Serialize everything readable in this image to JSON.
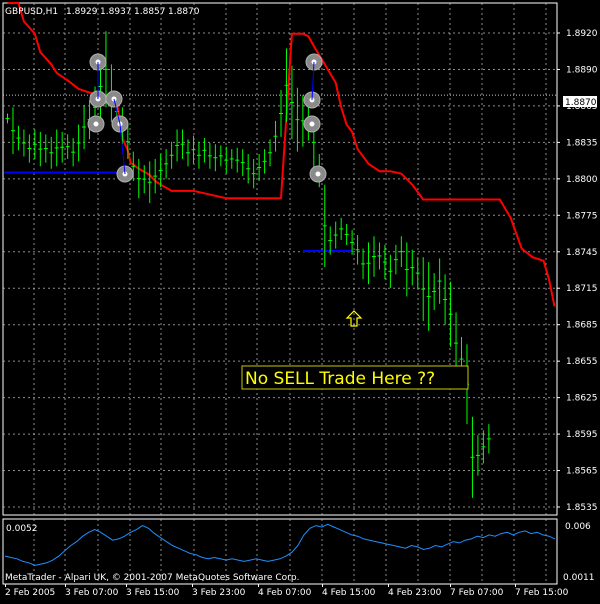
{
  "header": {
    "symbol_tf": "GBPUSD,H1",
    "open": "1.8929",
    "high": "1.8937",
    "low": "1.8857",
    "close": "1.8870"
  },
  "main_panel": {
    "y_ticks": [
      "1.8920",
      "1.8890",
      "1.8865",
      "1.8835",
      "1.8800",
      "1.8775",
      "1.8745",
      "1.8715",
      "1.8685",
      "1.8655",
      "1.8625",
      "1.8595",
      "1.8565",
      "1.8535"
    ],
    "current_price_label": "1.8870",
    "annotation": "No SELL Trade Here ??"
  },
  "sub_panel": {
    "value_label": "0.0052",
    "scale_max": "0.006",
    "scale_min": "0.0011"
  },
  "x_ticks": [
    "2 Feb 2005",
    "3 Feb 07:00",
    "3 Feb 15:00",
    "3 Feb 23:00",
    "4 Feb 07:00",
    "4 Feb 15:00",
    "4 Feb 23:00",
    "7 Feb 07:00",
    "7 Feb 15:00"
  ],
  "copyright": "MetaTrader - Alpari UK, © 2001-2007 MetaQuotes Software Corp.",
  "colors": {
    "background": "#000000",
    "grid": "#c8c8c8",
    "bars": "#00ff00",
    "trailing_stop": "#ff0000",
    "level_line": "#0000ff",
    "indicator": "#1e90ff",
    "annotation_text": "#ffff00"
  },
  "chart_data": [
    {
      "type": "candlestick",
      "title": "GBPUSD,H1",
      "ylim": [
        1.8528,
        1.8945
      ],
      "x_labels": [
        "2 Feb 2005",
        "3 Feb 07:00",
        "3 Feb 15:00",
        "3 Feb 23:00",
        "4 Feb 07:00",
        "4 Feb 15:00",
        "4 Feb 23:00",
        "7 Feb 07:00",
        "7 Feb 15:00"
      ],
      "grid": true,
      "bars": [
        [
          1.8847,
          1.8855
        ],
        [
          1.8822,
          1.886
        ],
        [
          1.8825,
          1.8845
        ],
        [
          1.882,
          1.8842
        ],
        [
          1.8815,
          1.8838
        ],
        [
          1.8818,
          1.8842
        ],
        [
          1.8812,
          1.884
        ],
        [
          1.8815,
          1.8838
        ],
        [
          1.881,
          1.8836
        ],
        [
          1.8812,
          1.8842
        ],
        [
          1.8815,
          1.884
        ],
        [
          1.8818,
          1.8838
        ],
        [
          1.8812,
          1.8835
        ],
        [
          1.8816,
          1.8846
        ],
        [
          1.8826,
          1.8862
        ],
        [
          1.8834,
          1.8866
        ],
        [
          1.8843,
          1.8877
        ],
        [
          1.8852,
          1.8902
        ],
        [
          1.886,
          1.8922
        ],
        [
          1.8848,
          1.8895
        ],
        [
          1.884,
          1.8873
        ],
        [
          1.883,
          1.886
        ],
        [
          1.8818,
          1.8846
        ],
        [
          1.88,
          1.8824
        ],
        [
          1.8786,
          1.8818
        ],
        [
          1.879,
          1.8813
        ],
        [
          1.8782,
          1.8816
        ],
        [
          1.879,
          1.8818
        ],
        [
          1.8795,
          1.8822
        ],
        [
          1.8802,
          1.8826
        ],
        [
          1.881,
          1.8832
        ],
        [
          1.8816,
          1.8842
        ],
        [
          1.8818,
          1.8842
        ],
        [
          1.8812,
          1.8834
        ],
        [
          1.8814,
          1.8837
        ],
        [
          1.881,
          1.8832
        ],
        [
          1.8815,
          1.8835
        ],
        [
          1.881,
          1.8831
        ],
        [
          1.8808,
          1.883
        ],
        [
          1.8812,
          1.8829
        ],
        [
          1.8806,
          1.8828
        ],
        [
          1.881,
          1.8826
        ],
        [
          1.8807,
          1.8827
        ],
        [
          1.8804,
          1.8826
        ],
        [
          1.8798,
          1.8822
        ],
        [
          1.8794,
          1.8818
        ],
        [
          1.88,
          1.8822
        ],
        [
          1.8806,
          1.8826
        ],
        [
          1.8812,
          1.8834
        ],
        [
          1.8824,
          1.8849
        ],
        [
          1.8836,
          1.8874
        ],
        [
          1.8848,
          1.8908
        ],
        [
          1.8834,
          1.8894
        ],
        [
          1.8824,
          1.8876
        ],
        [
          1.8828,
          1.887
        ],
        [
          1.8833,
          1.886
        ],
        [
          1.881,
          1.8853
        ],
        [
          1.8795,
          1.8822
        ],
        [
          1.873,
          1.8797
        ],
        [
          1.874,
          1.8763
        ],
        [
          1.8745,
          1.8767
        ],
        [
          1.8752,
          1.877
        ],
        [
          1.8748,
          1.8765
        ],
        [
          1.874,
          1.876
        ],
        [
          1.8732,
          1.8756
        ],
        [
          1.872,
          1.8745
        ],
        [
          1.8716,
          1.875
        ],
        [
          1.8722,
          1.8755
        ],
        [
          1.8728,
          1.875
        ],
        [
          1.872,
          1.8748
        ],
        [
          1.8713,
          1.874
        ],
        [
          1.8724,
          1.8748
        ],
        [
          1.873,
          1.8755
        ],
        [
          1.8706,
          1.875
        ],
        [
          1.8715,
          1.8744
        ],
        [
          1.8712,
          1.8738
        ],
        [
          1.8686,
          1.8738
        ],
        [
          1.8678,
          1.8734
        ],
        [
          1.8695,
          1.8725
        ],
        [
          1.87,
          1.8737
        ],
        [
          1.8683,
          1.8724
        ],
        [
          1.8665,
          1.8718
        ],
        [
          1.8643,
          1.8693
        ],
        [
          1.8637,
          1.8673
        ],
        [
          1.8602,
          1.8667
        ],
        [
          1.8542,
          1.8608
        ],
        [
          1.856,
          1.8593
        ],
        [
          1.857,
          1.8597
        ],
        [
          1.8578,
          1.8602
        ]
      ],
      "trailing_stop_series": [
        [
          0,
          1.8945
        ],
        [
          2,
          1.8945
        ],
        [
          3,
          1.893
        ],
        [
          5,
          1.892
        ],
        [
          6,
          1.8905
        ],
        [
          8,
          1.8895
        ],
        [
          9,
          1.8888
        ],
        [
          11,
          1.8882
        ],
        [
          13,
          1.8875
        ],
        [
          15,
          1.8872
        ],
        [
          17,
          1.887
        ],
        [
          18,
          1.8868
        ],
        [
          19,
          1.8868
        ],
        [
          19.9,
          1.8868
        ],
        [
          20.3,
          1.8855
        ],
        [
          21,
          1.8835
        ],
        [
          22,
          1.8825
        ],
        [
          22.5,
          1.8815
        ],
        [
          24,
          1.881
        ],
        [
          26,
          1.8805
        ],
        [
          27,
          1.88
        ],
        [
          28,
          1.8797
        ],
        [
          30,
          1.8792
        ],
        [
          32,
          1.8792
        ],
        [
          34,
          1.8792
        ],
        [
          36,
          1.879
        ],
        [
          38,
          1.8788
        ],
        [
          40,
          1.8786
        ],
        [
          42,
          1.8786
        ],
        [
          44,
          1.8786
        ],
        [
          46,
          1.8786
        ],
        [
          48,
          1.8786
        ],
        [
          50,
          1.8786
        ],
        [
          52,
          1.892
        ],
        [
          54,
          1.892
        ],
        [
          55,
          1.8918
        ],
        [
          56,
          1.891
        ],
        [
          58,
          1.8895
        ],
        [
          60,
          1.888
        ],
        [
          61,
          1.886
        ],
        [
          62,
          1.8846
        ],
        [
          63,
          1.884
        ],
        [
          64,
          1.8826
        ],
        [
          66,
          1.8814
        ],
        [
          68,
          1.8808
        ],
        [
          70,
          1.8808
        ],
        [
          72,
          1.8806
        ],
        [
          74,
          1.8797
        ],
        [
          76,
          1.8785
        ],
        [
          78,
          1.8785
        ],
        [
          80,
          1.8785
        ],
        [
          82,
          1.8785
        ],
        [
          84,
          1.8785
        ],
        [
          86,
          1.8785
        ],
        [
          88,
          1.8785
        ],
        [
          90,
          1.8785
        ],
        [
          92,
          1.877
        ],
        [
          94,
          1.8745
        ],
        [
          96,
          1.8738
        ],
        [
          98,
          1.8735
        ],
        [
          99,
          1.872
        ],
        [
          100,
          1.8698
        ]
      ]
    },
    {
      "type": "line",
      "title": "",
      "ylim": [
        0.0011,
        0.006
      ],
      "values": [
        0.0032,
        0.0031,
        0.003,
        0.0028,
        0.0027,
        0.0025,
        0.0026,
        0.0027,
        0.0029,
        0.0032,
        0.0036,
        0.004,
        0.0043,
        0.0047,
        0.005,
        0.0052,
        0.005,
        0.0047,
        0.0044,
        0.0045,
        0.0047,
        0.005,
        0.0052,
        0.0055,
        0.0053,
        0.0049,
        0.0046,
        0.0043,
        0.004,
        0.0038,
        0.0036,
        0.0034,
        0.0033,
        0.0031,
        0.003,
        0.0031,
        0.003,
        0.0029,
        0.003,
        0.0029,
        0.0028,
        0.0029,
        0.003,
        0.0029,
        0.0028,
        0.0029,
        0.003,
        0.0032,
        0.0035,
        0.004,
        0.0048,
        0.0053,
        0.0055,
        0.0054,
        0.0056,
        0.0054,
        0.0052,
        0.005,
        0.0048,
        0.0047,
        0.0045,
        0.0044,
        0.0043,
        0.0042,
        0.0041,
        0.004,
        0.0039,
        0.0038,
        0.004,
        0.0039,
        0.0037,
        0.0038,
        0.004,
        0.0039,
        0.0041,
        0.0043,
        0.0042,
        0.0044,
        0.0045,
        0.0047,
        0.0046,
        0.0048,
        0.0047,
        0.0049,
        0.005,
        0.0048,
        0.005,
        0.0051,
        0.0049,
        0.005,
        0.0048,
        0.0047,
        0.0045
      ]
    }
  ]
}
